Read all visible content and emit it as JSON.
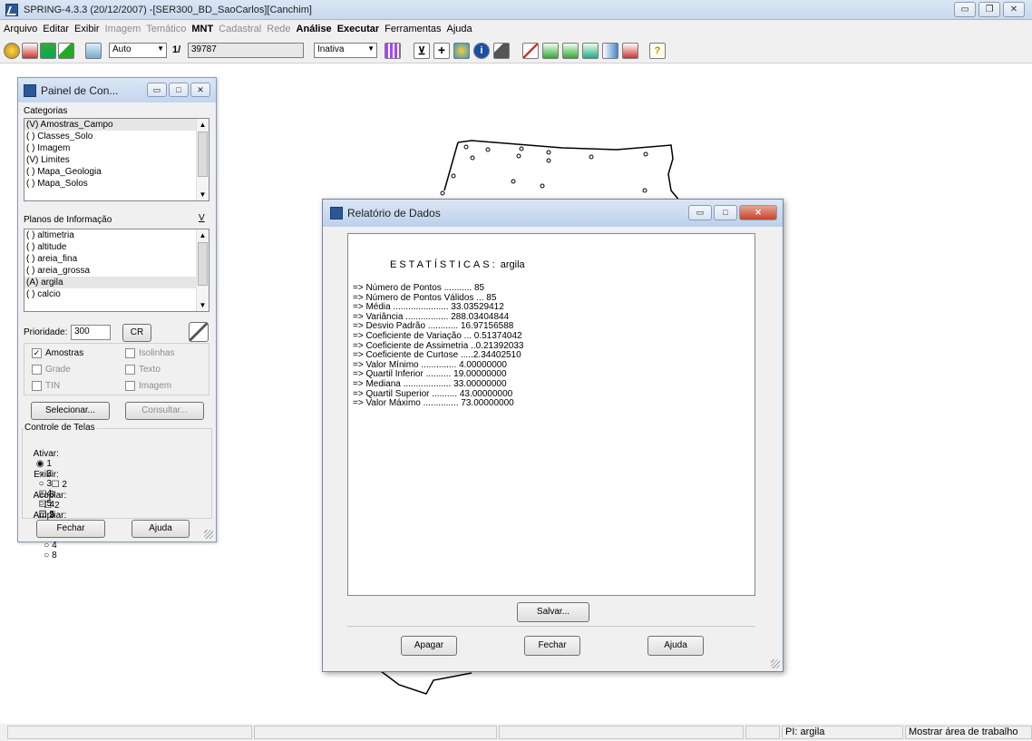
{
  "window": {
    "title": "SPRING-4.3.3 (20/12/2007) -[SER300_BD_SaoCarlos][Canchim]"
  },
  "menu": [
    {
      "label": "Arquivo",
      "enabled": true
    },
    {
      "label": "Editar",
      "enabled": true
    },
    {
      "label": "Exibir",
      "enabled": true
    },
    {
      "label": "Imagem",
      "enabled": false
    },
    {
      "label": "Temático",
      "enabled": false
    },
    {
      "label": "MNT",
      "enabled": true,
      "bold": true
    },
    {
      "label": "Cadastral",
      "enabled": false
    },
    {
      "label": "Rede",
      "enabled": false
    },
    {
      "label": "Análise",
      "enabled": true,
      "bold": true
    },
    {
      "label": "Executar",
      "enabled": true,
      "bold": true
    },
    {
      "label": "Ferramentas",
      "enabled": true
    },
    {
      "label": "Ajuda",
      "enabled": true
    }
  ],
  "toolbar": {
    "scale_mode": "Auto",
    "scale_prefix": "1/",
    "scale_value": "39787",
    "mode_select": "Inativa"
  },
  "control_panel": {
    "title": "Painel de Con...",
    "categories_label": "Categorias",
    "categories": [
      {
        "label": "(V) Amostras_Campo",
        "selected": true
      },
      {
        "label": "( ) Classes_Solo",
        "selected": false
      },
      {
        "label": "( ) Imagem",
        "selected": false
      },
      {
        "label": "(V) Limites",
        "selected": false
      },
      {
        "label": "( ) Mapa_Geologia",
        "selected": false
      },
      {
        "label": "( ) Mapa_Solos",
        "selected": false
      }
    ],
    "planes_label": "Planos de Informação",
    "planes_toggle": "V",
    "planes": [
      {
        "label": "( ) altimetria",
        "selected": false
      },
      {
        "label": "( ) altitude",
        "selected": false
      },
      {
        "label": "( ) areia_fina",
        "selected": false
      },
      {
        "label": "( ) areia_grossa",
        "selected": false
      },
      {
        "label": "(A) argila",
        "selected": true
      },
      {
        "label": "( ) calcio",
        "selected": false
      }
    ],
    "priority_label": "Prioridade:",
    "priority_value": "300",
    "cr_button": "CR",
    "checkboxes": {
      "amostras": {
        "label": "Amostras",
        "checked": true
      },
      "isolinhas": {
        "label": "Isolinhas",
        "checked": false
      },
      "grade": {
        "label": "Grade",
        "checked": false
      },
      "texto": {
        "label": "Texto",
        "checked": false
      },
      "tin": {
        "label": "TIN",
        "checked": false
      },
      "imagem": {
        "label": "Imagem",
        "checked": false
      }
    },
    "select_button": "Selecionar...",
    "consult_button": "Consultar...",
    "screens_group": "Controle de Telas",
    "ativar_label": "Ativar:",
    "exibir_label": "Exibir:",
    "acoplar_label": "Acoplar:",
    "ampliar_label": "Ampliar:",
    "ativar_opts": [
      "1",
      "2",
      "3",
      "4",
      "5"
    ],
    "exibir_opts": [
      "2",
      "3",
      "4",
      "5"
    ],
    "acoplar_opts": [
      "2",
      "3",
      "4",
      "5"
    ],
    "ampliar_opts": [
      "1",
      "2",
      "4",
      "8"
    ],
    "close_button": "Fechar",
    "help_button": "Ajuda"
  },
  "report": {
    "title": "Relatório de Dados",
    "header_spaced": "ESTATÍSTICAS:",
    "header_var": "argila",
    "lines": [
      "=> Número de Pontos ........... 85",
      "=> Número de Pontos Válidos ... 85",
      "=> Média ...................... 33.03529412",
      "=> Variância ................. 288.03404844",
      "=> Desvio Padrão ............ 16.97156588",
      "=> Coeficiente de Variação ... 0.51374042",
      "=> Coeficiente de Assimetria ..0.21392033",
      "=> Coeficiente de Curtose .....2.34402510",
      "=> Valor Mínimo .............. 4.00000000",
      "=> Quartil Inferior .......... 19.00000000",
      "=> Mediana ................... 33.00000000",
      "=> Quartil Superior .......... 43.00000000",
      "=> Valor Máximo .............. 73.00000000"
    ],
    "save_button": "Salvar...",
    "clear_button": "Apagar",
    "close_button": "Fechar",
    "help_button": "Ajuda"
  },
  "status": {
    "pi_label": "PI: argila",
    "show_area": "Mostrar área de trabalho"
  }
}
